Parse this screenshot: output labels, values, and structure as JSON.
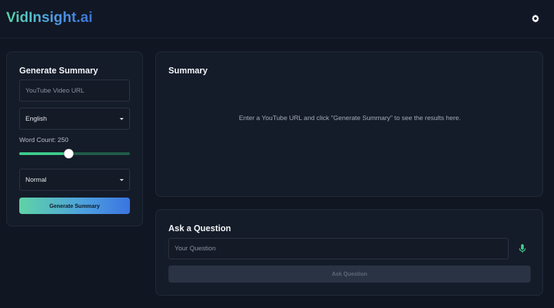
{
  "app": {
    "title": "VidInsight.ai"
  },
  "header": {
    "settings_icon": "gear-icon"
  },
  "generate_panel": {
    "title": "Generate Summary",
    "url_placeholder": "YouTube Video URL",
    "language": "English",
    "word_count_label": "Word Count: 250",
    "word_count_value": 250,
    "word_count_min": 50,
    "word_count_max": 500,
    "style": "Normal",
    "button_label": "Generate Summary"
  },
  "summary_panel": {
    "title": "Summary",
    "placeholder": "Enter a YouTube URL and click \"Generate Summary\" to see the results here."
  },
  "ask_panel": {
    "title": "Ask a Question",
    "question_placeholder": "Your Question",
    "mic_icon": "microphone-icon",
    "button_label": "Ask Question"
  },
  "colors": {
    "accent_green": "#3fcb8e",
    "accent_blue": "#3b74e0",
    "background": "#101622",
    "panel": "#151c29"
  }
}
